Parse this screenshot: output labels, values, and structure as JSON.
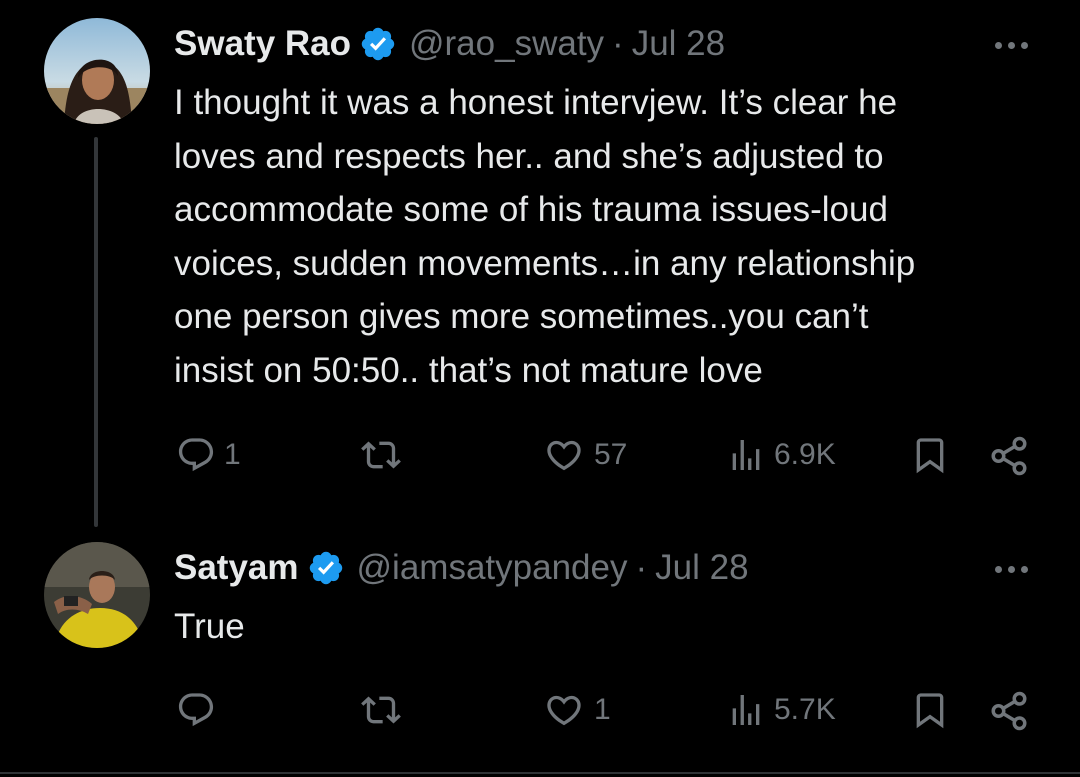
{
  "tweets": [
    {
      "name": "Swaty Rao",
      "handle": "@rao_swaty",
      "separator": "·",
      "date": "Jul 28",
      "verified": true,
      "text": "I thought it was a honest intervjew. It’s clear he\nloves and respects her.. and she’s adjusted to\naccommodate some of his trauma issues-loud\nvoices, sudden movements…in any relationship\none person gives more sometimes..you can’t\ninsist on 50:50.. that’s  not mature love",
      "replies": "1",
      "retweets": "",
      "likes": "57",
      "views": "6.9K"
    },
    {
      "name": "Satyam",
      "handle": "@iamsatypandey",
      "separator": "·",
      "date": "Jul 28",
      "verified": true,
      "text": "True",
      "replies": "",
      "retweets": "",
      "likes": "1",
      "views": "5.7K"
    }
  ],
  "colors": {
    "background": "#000000",
    "primary_text": "#e7e9ea",
    "secondary_text": "#71767b",
    "verified_badge": "#1d9bf0",
    "thread_line": "#333639"
  },
  "icons": [
    "verified-badge-icon",
    "more-icon",
    "reply-icon",
    "retweet-icon",
    "like-icon",
    "views-icon",
    "bookmark-icon",
    "share-icon"
  ]
}
